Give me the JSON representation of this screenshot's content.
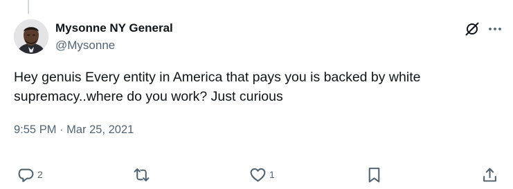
{
  "tweet": {
    "author_name": "Mysonne NY General",
    "author_handle": "@Mysonne",
    "text": "Hey genuis Every entity in America that pays you is backed by white supremacy..where do you work? Just curious",
    "timestamp": "9:55 PM · Mar 25, 2021"
  },
  "actions": {
    "reply_count": "2",
    "retweet_count": "",
    "like_count": "1"
  },
  "icons": {
    "grok": "grok-icon",
    "more": "more-icon",
    "reply": "reply-icon",
    "retweet": "retweet-icon",
    "like": "heart-icon",
    "bookmark": "bookmark-icon",
    "share": "share-icon"
  },
  "colors": {
    "text_primary": "#0f1419",
    "text_secondary": "#536471",
    "thread_line": "#cfd9de"
  }
}
